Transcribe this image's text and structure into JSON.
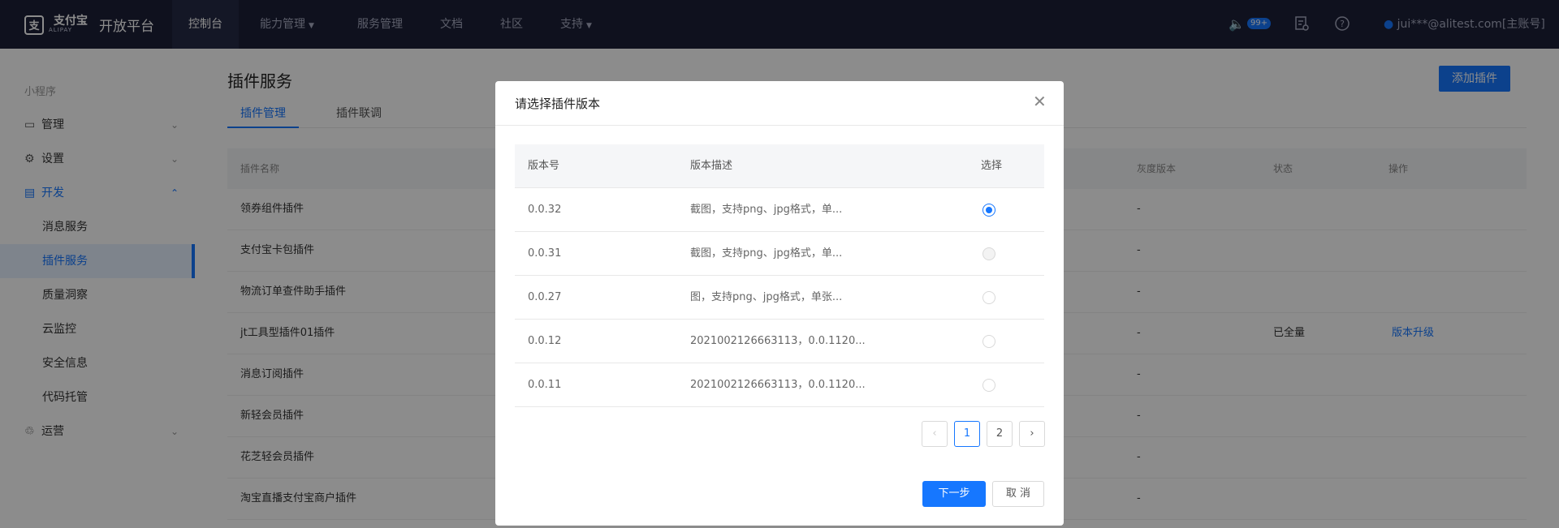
{
  "topbar": {
    "logo_mark": "支",
    "logo_name": "支付宝",
    "logo_sub": "ALIPAY",
    "platform": "开放平台",
    "nav": [
      {
        "label": "控制台"
      },
      {
        "label": "能力管理"
      },
      {
        "label": "服务管理"
      },
      {
        "label": "文档"
      },
      {
        "label": "社区"
      },
      {
        "label": "支持"
      }
    ],
    "badge": "99+",
    "account": "jui***@alitest.com[主账号]"
  },
  "sidebar": {
    "group_label": "小程序",
    "items": [
      {
        "label": "管理"
      },
      {
        "label": "设置"
      },
      {
        "label": "开发"
      },
      {
        "label": "运营"
      }
    ],
    "sub_items": [
      {
        "label": "消息服务"
      },
      {
        "label": "插件服务"
      },
      {
        "label": "质量洞察"
      },
      {
        "label": "云监控"
      },
      {
        "label": "安全信息"
      },
      {
        "label": "代码托管"
      }
    ]
  },
  "main": {
    "title": "插件服务",
    "add_button": "添加插件",
    "tabs": [
      {
        "label": "插件管理"
      },
      {
        "label": "插件联调"
      }
    ],
    "columns": {
      "name": "插件名称",
      "gray": "灰度版本",
      "status": "状态",
      "action": "操作"
    },
    "rows": [
      {
        "name": "领券组件插件",
        "gray": "-",
        "status": "",
        "action": ""
      },
      {
        "name": "支付宝卡包插件",
        "gray": "-",
        "status": "",
        "action": ""
      },
      {
        "name": "物流订单查件助手插件",
        "gray": "-",
        "status": "",
        "action": ""
      },
      {
        "name": "jt工具型插件01插件",
        "gray": "-",
        "status": "已全量",
        "action": "版本升级"
      },
      {
        "name": "消息订阅插件",
        "gray": "-",
        "status": "",
        "action": ""
      },
      {
        "name": "新轻会员插件",
        "gray": "-",
        "status": "",
        "action": ""
      },
      {
        "name": "花芝轻会员插件",
        "gray": "-",
        "status": "",
        "action": ""
      },
      {
        "name": "淘宝直播支付宝商户插件",
        "gray": "-",
        "status": "",
        "action": ""
      }
    ]
  },
  "modal": {
    "title": "请选择插件版本",
    "columns": {
      "version": "版本号",
      "desc": "版本描述",
      "select": "选择"
    },
    "rows": [
      {
        "version": "0.0.32",
        "desc": "截图，支持png、jpg格式，单..."
      },
      {
        "version": "0.0.31",
        "desc": "截图，支持png、jpg格式，单..."
      },
      {
        "version": "0.0.27",
        "desc": "图，支持png、jpg格式，单张..."
      },
      {
        "version": "0.0.12",
        "desc": "2021002126663113，0.0.1120..."
      },
      {
        "version": "0.0.11",
        "desc": "2021002126663113，0.0.1120..."
      }
    ],
    "pagination": {
      "prev": "‹",
      "pages": [
        "1",
        "2"
      ],
      "next": "›"
    },
    "next_button": "下一步",
    "cancel_button": "取 消"
  },
  "colors": {
    "topbar_bg": "#1c1f37",
    "accent": "#1677ff"
  }
}
